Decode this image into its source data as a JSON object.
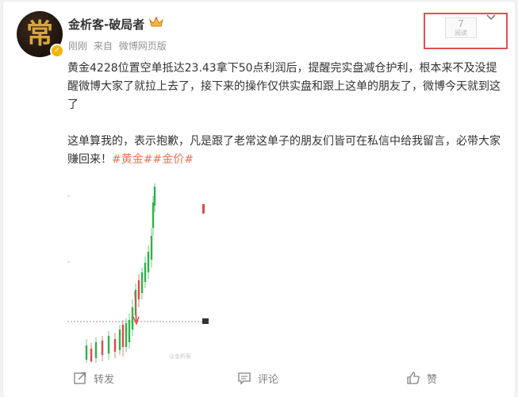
{
  "user": {
    "avatar_char": "常",
    "name": "金析客-破局者",
    "verified_mark": "✓"
  },
  "meta": {
    "time": "刚刚",
    "source_prefix": "来自",
    "source": "微博网页版"
  },
  "read": {
    "count": "7",
    "label": "阅读"
  },
  "post": {
    "paragraph1": "黄金4228位置空单抵达23.43拿下50点利润后，提醒完实盘减仓护利，根本来不及没提醒微博大家了就拉上去了，接下来的操作仅供实盘和跟上这单的朋友了，微博今天就到这了",
    "paragraph2": "这单算我的，表示抱歉，凡是跟了老常这单子的朋友们皆可在私信中给我留言，必带大家赚回来！",
    "hashtags": [
      "#黄金#",
      "#金价#"
    ]
  },
  "image": {
    "watermark": "@金析客"
  },
  "actions": {
    "repost": "转发",
    "comment": "评论",
    "like": "赞"
  },
  "colors": {
    "accent": "#eb7350",
    "highlight_border": "#e05050",
    "candle_up": "#2fb24a",
    "candle_down": "#e04848"
  }
}
